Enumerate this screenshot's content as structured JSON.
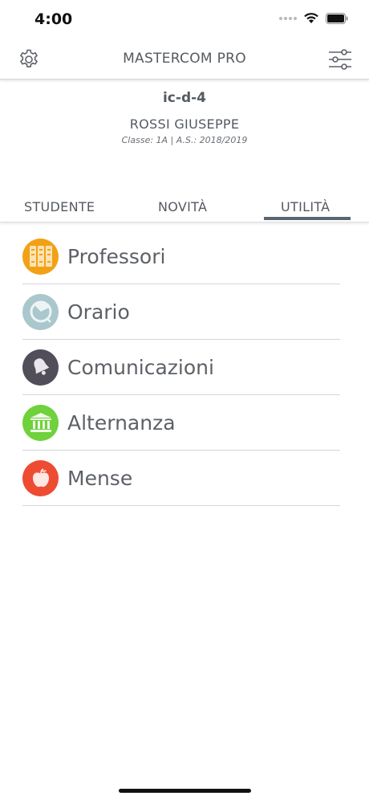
{
  "status_bar": {
    "time": "4:00"
  },
  "nav": {
    "title": "MASTERCOM PRO"
  },
  "profile": {
    "code": "ic-d-4",
    "name": "ROSSI GIUSEPPE",
    "class_info": "Classe: 1A | A.S.: 2018/2019"
  },
  "tabs": [
    {
      "label": "STUDENTE",
      "selected": false
    },
    {
      "label": "NOVITÀ",
      "selected": false
    },
    {
      "label": "UTILITÀ",
      "selected": true
    }
  ],
  "menu": [
    {
      "label": "Professori",
      "icon": "books-icon",
      "color": "#f2a116"
    },
    {
      "label": "Orario",
      "icon": "clock-icon",
      "color": "#a9c7cc"
    },
    {
      "label": "Comunicazioni",
      "icon": "bell-icon",
      "color": "#514e59"
    },
    {
      "label": "Alternanza",
      "icon": "building-icon",
      "color": "#6fd13b"
    },
    {
      "label": "Mense",
      "icon": "apple-icon",
      "color": "#ee4b33"
    }
  ]
}
